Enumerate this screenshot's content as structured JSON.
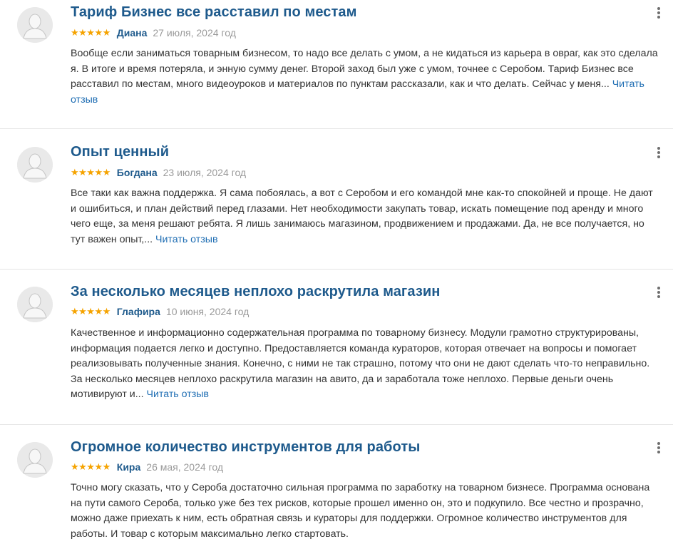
{
  "colors": {
    "title": "#1e5a8c",
    "link": "#1e6db3",
    "stars": "#f5a300",
    "date": "#9a9a9a",
    "text": "#333333",
    "divider": "#e4e4e4"
  },
  "icons": {
    "avatar": "user-silhouette-icon",
    "menu": "vertical-ellipsis-icon",
    "rating": "star-icon"
  },
  "reviews": [
    {
      "title": "Тариф Бизнес все расставил по местам",
      "rating": 5,
      "stars": "★★★★★",
      "author": "Диана",
      "date": "27 июля, 2024 год",
      "text": "Вообще если заниматься товарным бизнесом, то надо все делать с умом, а не кидаться из карьера в овраг, как это сделала я. В итоге и время потеряла, и энную сумму денег. Второй заход был уже с умом, точнее с Серобом. Тариф Бизнес все расставил по местам, много видеоуроков и материалов по пунктам рассказали, как и что делать. Сейчас у меня...",
      "read_more": "Читать отзыв"
    },
    {
      "title": "Опыт ценный",
      "rating": 5,
      "stars": "★★★★★",
      "author": "Богдана",
      "date": "23 июля, 2024 год",
      "text": "Все таки как важна поддержка. Я сама побоялась, а вот с Серобом и его командой мне как-то спокойней и проще. Не дают и ошибиться, и план действий перед глазами. Нет необходимости закупать товар, искать помещение под аренду и много чего еще, за меня решают ребята. Я лишь занимаюсь магазином, продвижением и продажами. Да, не все получается, но тут важен опыт,...",
      "read_more": "Читать отзыв"
    },
    {
      "title": "За несколько месяцев неплохо раскрутила магазин",
      "rating": 5,
      "stars": "★★★★★",
      "author": "Глафира",
      "date": "10 июня, 2024 год",
      "text": "Качественное и информационно содержательная программа по товарному бизнесу. Модули грамотно структурированы, информация подается легко и доступно. Предоставляется команда кураторов, которая отвечает на вопросы и помогает реализовывать полученные знания. Конечно, с ними не так страшно, потому что они не дают сделать что-то неправильно. За несколько месяцев неплохо раскрутила магазин на авито, да и заработала тоже неплохо. Первые деньги очень мотивируют и...",
      "read_more": "Читать отзыв"
    },
    {
      "title": "Огромное количество инструментов для работы",
      "rating": 5,
      "stars": "★★★★★",
      "author": "Кира",
      "date": "26 мая, 2024 год",
      "text": "Точно могу сказать, что у Сероба достаточно сильная программа по заработку на товарном бизнесе. Программа основана на пути самого Сероба, только уже без тех рисков, которые прошел именно он, это и подкупило. Все честно и прозрачно, можно даже приехать к ним, есть обратная связь и кураторы для поддержки. Огромное количество инструментов для работы. И товар с которым максимально легко стартовать.",
      "read_more": ""
    }
  ]
}
